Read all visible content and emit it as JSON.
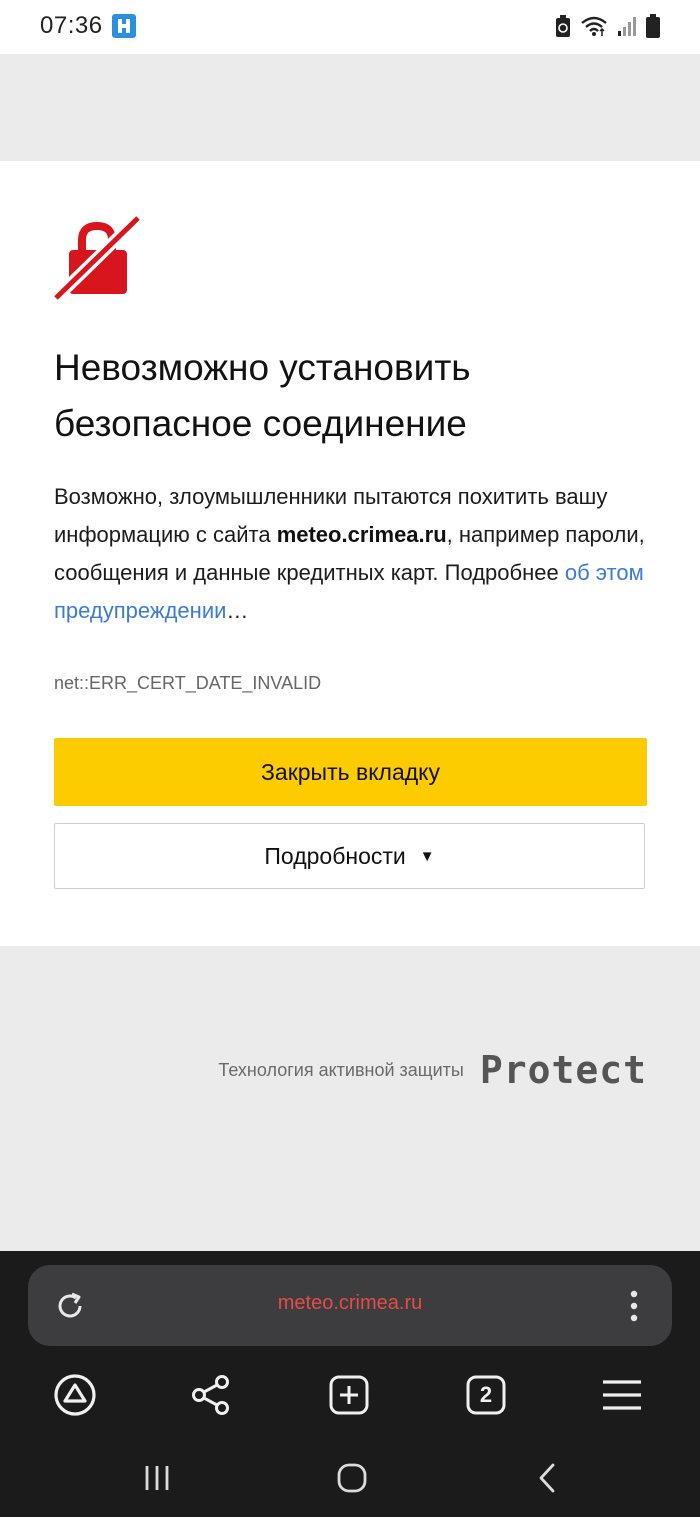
{
  "status_bar": {
    "time": "07:36"
  },
  "error": {
    "title": "Невозможно установить безопасное соединение",
    "desc_part1": "Возможно, злоумышленники пытаются похитить вашу информацию с сайта ",
    "desc_site": "meteo.crimea.ru",
    "desc_part2": ", например пароли, сообщения и данные кредитных карт. Подробнее ",
    "desc_link": "об этом предупреждении",
    "desc_ellipsis": "…",
    "error_code": "net::ERR_CERT_DATE_INVALID"
  },
  "buttons": {
    "close_tab": "Закрыть вкладку",
    "details": "Подробности",
    "details_caret": "▼"
  },
  "footer": {
    "protect_text": "Технология активной защиты",
    "protect_logo": "Protect"
  },
  "browser": {
    "url": "meteo.crimea.ru",
    "tabs_count": "2"
  },
  "colors": {
    "accent_yellow": "#fccc00",
    "lock_red": "#d8141c",
    "link_blue": "#3a7bd5",
    "url_red": "#e24d45"
  },
  "icons": {
    "status_app": "app-notification-icon",
    "battery_saver": "battery-saver-icon",
    "wifi": "wifi-icon",
    "signal": "signal-icon",
    "battery": "battery-icon",
    "lock": "broken-lock-icon",
    "reload": "reload-icon",
    "menu": "more-vertical-icon",
    "alice": "alice-icon",
    "share": "share-icon",
    "new_tab": "new-tab-icon",
    "tabs": "tabs-icon",
    "hamburger": "hamburger-menu-icon",
    "recent_apps": "recent-apps-icon",
    "home": "home-icon",
    "back": "back-icon"
  }
}
